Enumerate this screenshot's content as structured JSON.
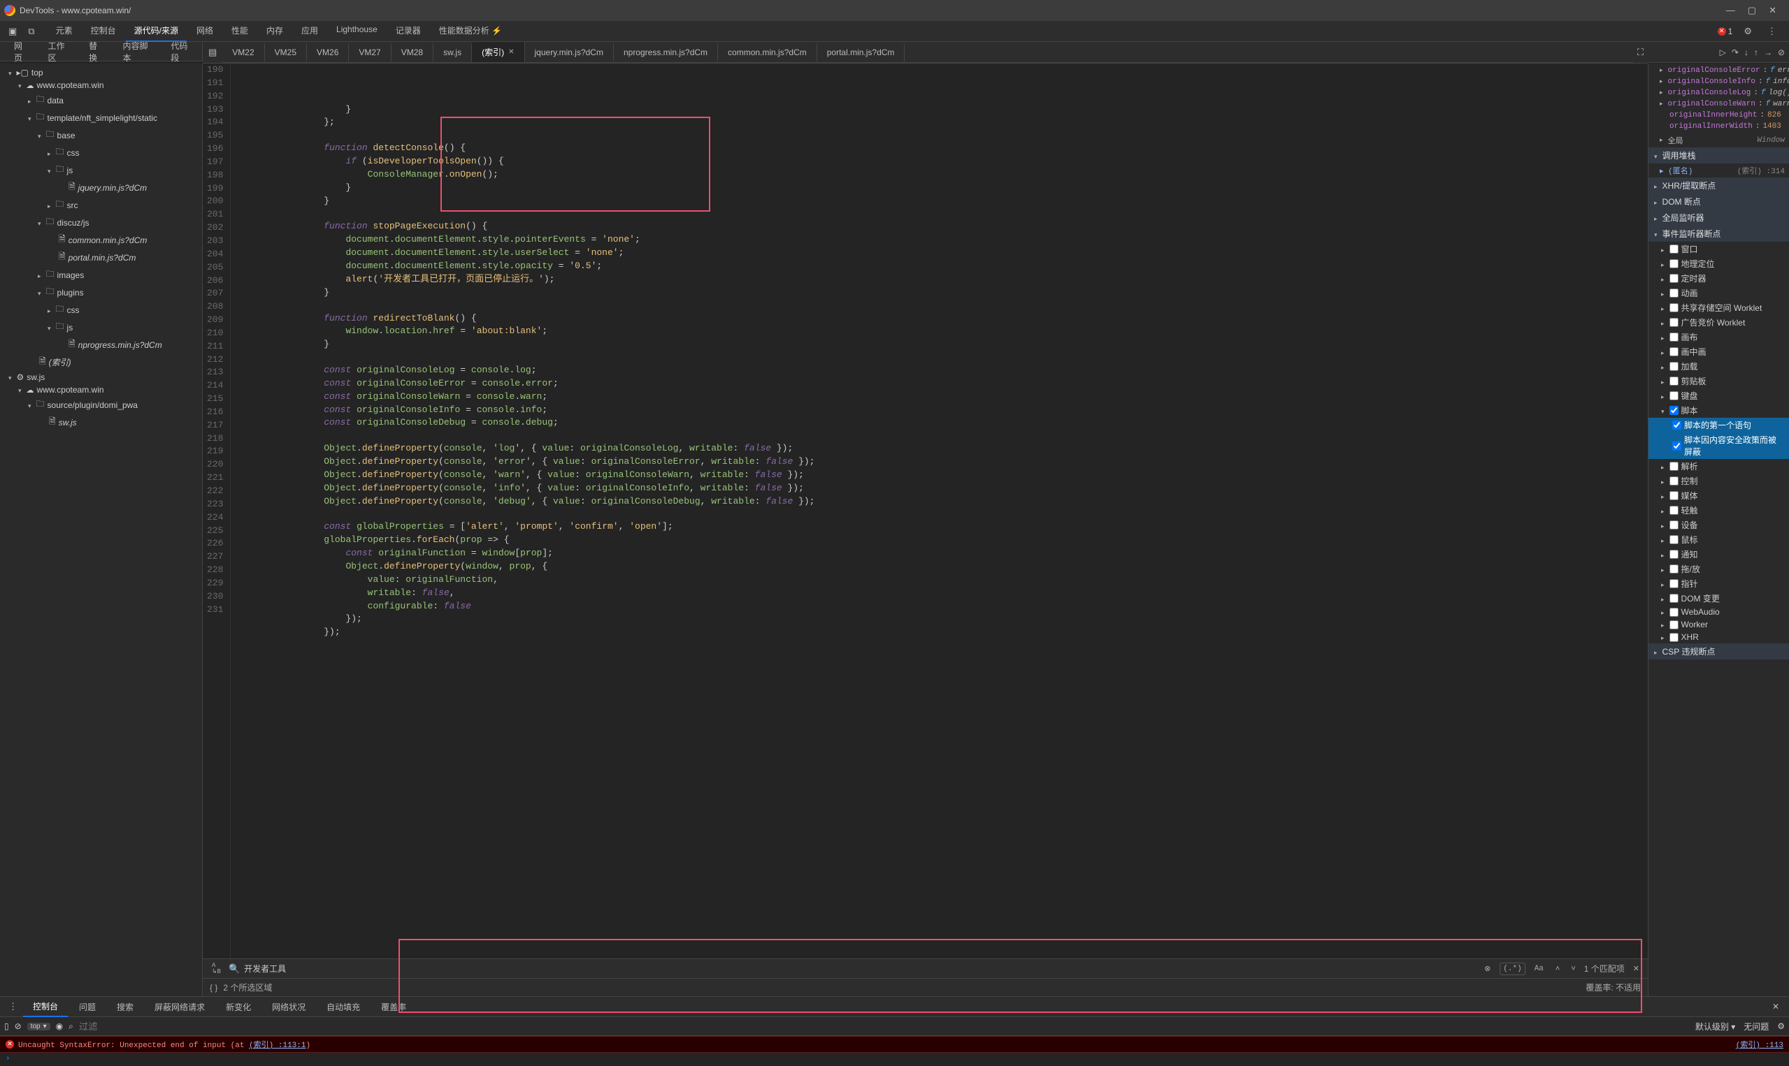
{
  "title": "DevTools - www.cpoteam.win/",
  "top_tabs": [
    "元素",
    "控制台",
    "源代码/来源",
    "网络",
    "性能",
    "内存",
    "应用",
    "Lighthouse",
    "记录器",
    "性能数据分析 ⚡"
  ],
  "top_active": 2,
  "error_count": "1",
  "subbar_tabs": [
    "网页",
    "工作区",
    "替换",
    "内容脚本",
    "代码段"
  ],
  "file_tabs": [
    "VM22",
    "VM25",
    "VM26",
    "VM27",
    "VM28",
    "sw.js",
    "(索引)",
    "jquery.min.js?dCm",
    "nprogress.min.js?dCm",
    "common.min.js?dCm",
    "portal.min.js?dCm"
  ],
  "file_active": 6,
  "tree": [
    {
      "d": 0,
      "t": "top",
      "open": true,
      "kind": "top"
    },
    {
      "d": 1,
      "t": "www.cpoteam.win",
      "open": true,
      "kind": "cloud"
    },
    {
      "d": 2,
      "t": "data",
      "open": false,
      "kind": "folder"
    },
    {
      "d": 2,
      "t": "template/nft_simplelight/static",
      "open": true,
      "kind": "folder"
    },
    {
      "d": 3,
      "t": "base",
      "open": true,
      "kind": "folder"
    },
    {
      "d": 4,
      "t": "css",
      "open": false,
      "kind": "folder"
    },
    {
      "d": 4,
      "t": "js",
      "open": true,
      "kind": "folder"
    },
    {
      "d": 5,
      "t": "jquery.min.js?dCm",
      "kind": "file"
    },
    {
      "d": 4,
      "t": "src",
      "open": false,
      "kind": "folder"
    },
    {
      "d": 3,
      "t": "discuz/js",
      "open": true,
      "kind": "folder"
    },
    {
      "d": 4,
      "t": "common.min.js?dCm",
      "kind": "file"
    },
    {
      "d": 4,
      "t": "portal.min.js?dCm",
      "kind": "file"
    },
    {
      "d": 3,
      "t": "images",
      "open": false,
      "kind": "folder"
    },
    {
      "d": 3,
      "t": "plugins",
      "open": true,
      "kind": "folder"
    },
    {
      "d": 4,
      "t": "css",
      "open": false,
      "kind": "folder"
    },
    {
      "d": 4,
      "t": "js",
      "open": true,
      "kind": "folder"
    },
    {
      "d": 5,
      "t": "nprogress.min.js?dCm",
      "kind": "file"
    },
    {
      "d": 2,
      "t": "(索引)",
      "kind": "file"
    },
    {
      "d": 0,
      "t": "sw.js",
      "open": true,
      "kind": "gear"
    },
    {
      "d": 1,
      "t": "www.cpoteam.win",
      "open": true,
      "kind": "cloud"
    },
    {
      "d": 2,
      "t": "source/plugin/domi_pwa",
      "open": true,
      "kind": "folder"
    },
    {
      "d": 3,
      "t": "sw.js",
      "kind": "file"
    }
  ],
  "gutter_start": 190,
  "gutter_end": 231,
  "code": [
    "                    }",
    "                };",
    "",
    "                function detectConsole() {",
    "                    if (isDeveloperToolsOpen()) {",
    "                        ConsoleManager.onOpen();",
    "                    }",
    "                }",
    "",
    "                function stopPageExecution() {",
    "                    document.documentElement.style.pointerEvents = 'none';",
    "                    document.documentElement.style.userSelect = 'none';",
    "                    document.documentElement.style.opacity = '0.5';",
    "                    alert('开发者工具已打开，页面已停止运行。');",
    "                }",
    "",
    "                function redirectToBlank() {",
    "                    window.location.href = 'about:blank';",
    "                }",
    "",
    "                const originalConsoleLog = console.log;",
    "                const originalConsoleError = console.error;",
    "                const originalConsoleWarn = console.warn;",
    "                const originalConsoleInfo = console.info;",
    "                const originalConsoleDebug = console.debug;",
    "",
    "                Object.defineProperty(console, 'log', { value: originalConsoleLog, writable: false });",
    "                Object.defineProperty(console, 'error', { value: originalConsoleError, writable: false });",
    "                Object.defineProperty(console, 'warn', { value: originalConsoleWarn, writable: false });",
    "                Object.defineProperty(console, 'info', { value: originalConsoleInfo, writable: false });",
    "                Object.defineProperty(console, 'debug', { value: originalConsoleDebug, writable: false });",
    "",
    "                const globalProperties = ['alert', 'prompt', 'confirm', 'open'];",
    "                globalProperties.forEach(prop => {",
    "                    const originalFunction = window[prop];",
    "                    Object.defineProperty(window, prop, {",
    "                        value: originalFunction,",
    "                        writable: false,",
    "                        configurable: false",
    "                    });",
    "                });",
    ""
  ],
  "search": {
    "text": "开发者工具",
    "match_count": "1 个匹配项",
    "cancel_char": "⊗",
    "regex_btn": "(.*)",
    "case_btn": "Aa"
  },
  "status": {
    "regions": "2 个所选区域",
    "coverage": "覆盖率: 不适用"
  },
  "right": {
    "scope_rows": [
      {
        "name": "originalConsoleError",
        "val": "f error()",
        "arrow": true
      },
      {
        "name": "originalConsoleInfo",
        "val": "f info()",
        "arrow": true
      },
      {
        "name": "originalConsoleLog",
        "val": "f log()",
        "arrow": true
      },
      {
        "name": "originalConsoleWarn",
        "val": "f warn()",
        "arrow": true
      },
      {
        "name": "originalInnerHeight",
        "val": "826",
        "arrow": false
      },
      {
        "name": "originalInnerWidth",
        "val": "1403",
        "arrow": false
      }
    ],
    "global_label": "全局",
    "global_right": "Window",
    "callstack_header": "调用堆栈",
    "callstack_item": "(匿名)",
    "callstack_right": "(索引) :314",
    "sections": [
      "XHR/提取断点",
      "DOM 断点",
      "全局监听器",
      "事件监听器断点"
    ],
    "events": [
      {
        "t": "窗口",
        "c": false
      },
      {
        "t": "地理定位",
        "c": false
      },
      {
        "t": "定时器",
        "c": false
      },
      {
        "t": "动画",
        "c": false
      },
      {
        "t": "共享存储空间 Worklet",
        "c": false
      },
      {
        "t": "广告竞价 Worklet",
        "c": false
      },
      {
        "t": "画布",
        "c": false
      },
      {
        "t": "画中画",
        "c": false
      },
      {
        "t": "加载",
        "c": false
      },
      {
        "t": "剪贴板",
        "c": false
      },
      {
        "t": "键盘",
        "c": false
      }
    ],
    "script_header": "脚本",
    "script_checked": true,
    "script_children": [
      {
        "t": "脚本的第一个语句",
        "c": true
      },
      {
        "t": "脚本因内容安全政策而被屏蔽",
        "c": true
      }
    ],
    "events2": [
      {
        "t": "解析",
        "c": false
      },
      {
        "t": "控制",
        "c": false
      },
      {
        "t": "媒体",
        "c": false
      },
      {
        "t": "轻触",
        "c": false
      },
      {
        "t": "设备",
        "c": false
      },
      {
        "t": "鼠标",
        "c": false
      },
      {
        "t": "通知",
        "c": false
      },
      {
        "t": "拖/放",
        "c": false
      },
      {
        "t": "指针",
        "c": false
      },
      {
        "t": "DOM 变更",
        "c": false
      },
      {
        "t": "WebAudio",
        "c": false
      },
      {
        "t": "Worker",
        "c": false
      },
      {
        "t": "XHR",
        "c": false
      }
    ],
    "csp_header": "CSP 违规断点"
  },
  "console_tabs": [
    "控制台",
    "问题",
    "搜索",
    "屏蔽网络请求",
    "新变化",
    "网络状况",
    "自动填充",
    "覆盖率"
  ],
  "console_active": 0,
  "console_filter": {
    "context": "top",
    "filter_placeholder": "过滤",
    "level": "默认级别",
    "issues": "无问题"
  },
  "console_error": {
    "msg": "Uncaught SyntaxError: Unexpected end of input (at ",
    "link_inline": "(索引) :113:1",
    "tail": ")",
    "source": "(索引) :113"
  }
}
